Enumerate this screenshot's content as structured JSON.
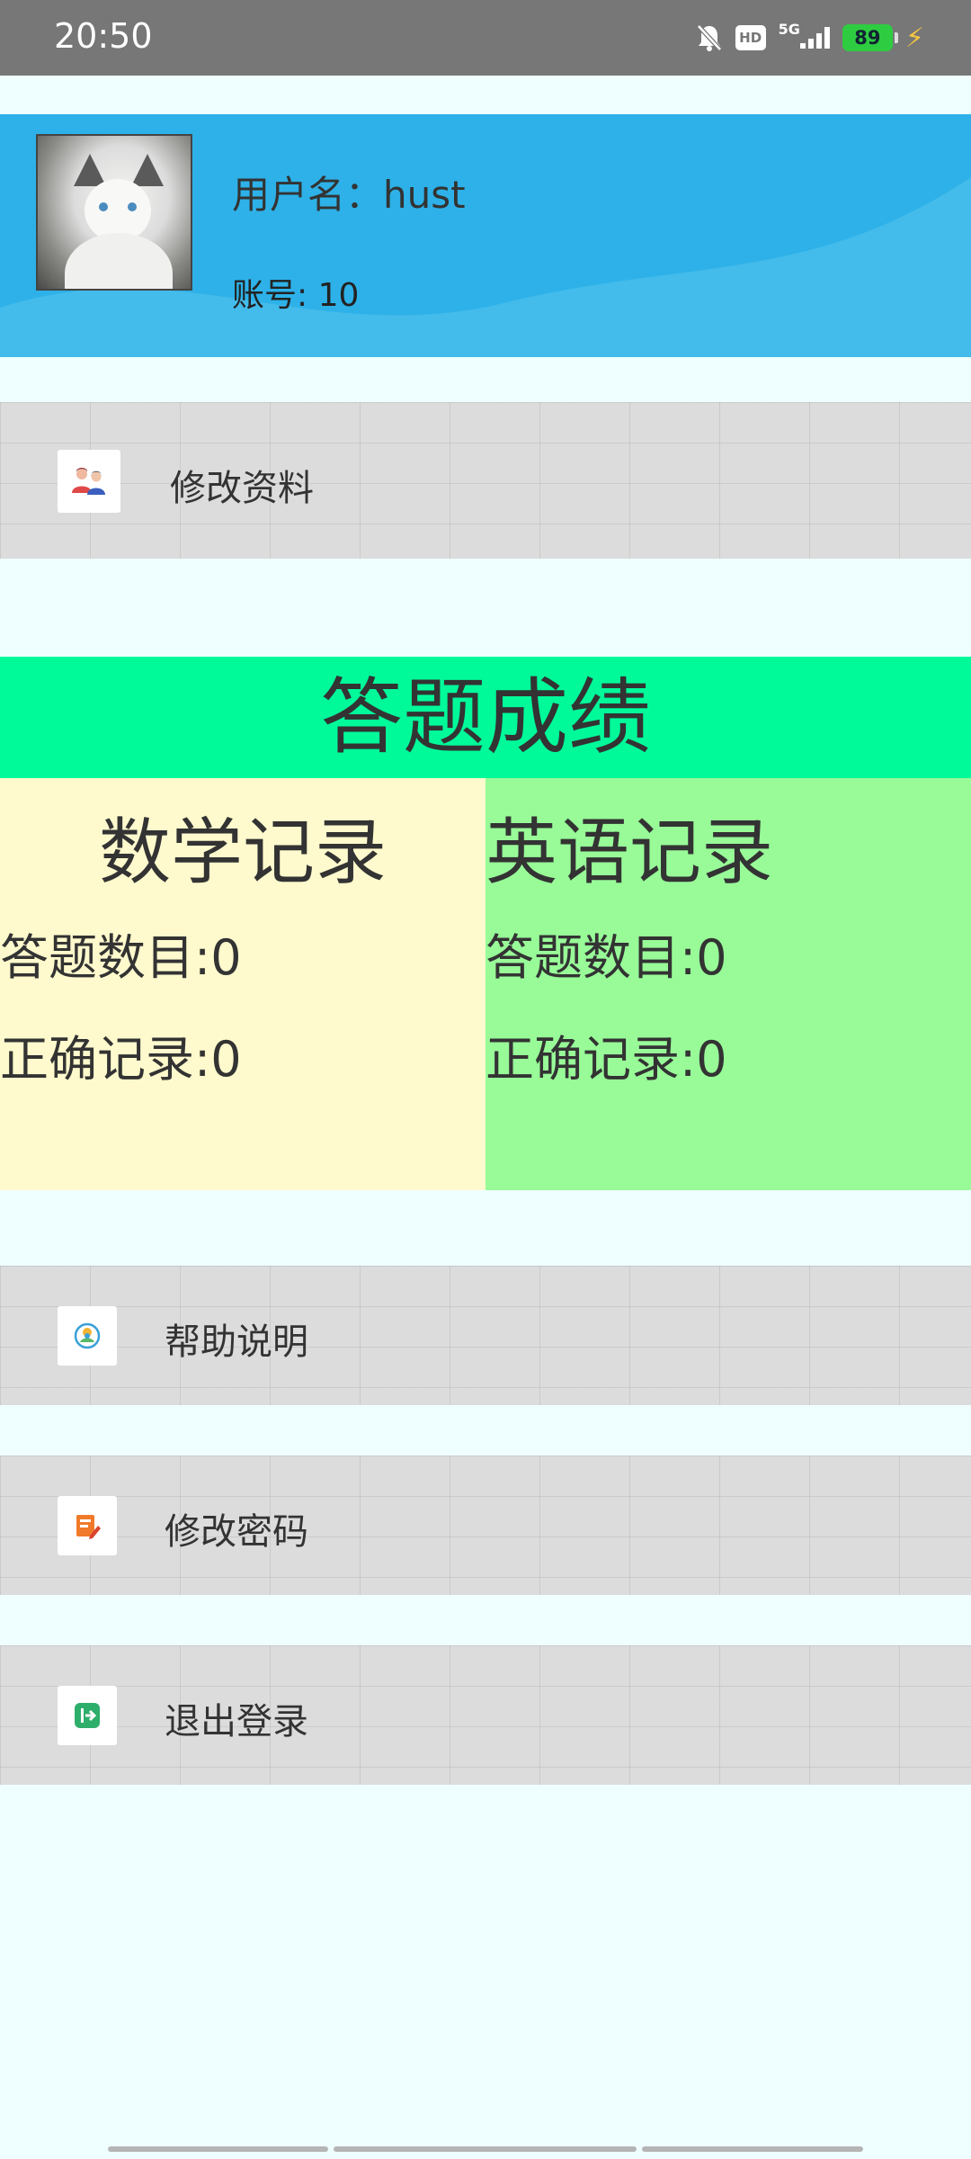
{
  "status_bar": {
    "time": "20:50",
    "icons": [
      "bell-mute-icon",
      "hd-icon",
      "5g-signal-icon",
      "battery-icon",
      "charging-bolt-icon"
    ],
    "hd_label": "HD",
    "network_label": "5G",
    "battery_level": "89"
  },
  "profile": {
    "username_label": "用户名：hust",
    "account_label": "账号: 10",
    "colors": {
      "card": "#2db1e8"
    }
  },
  "menu": {
    "edit_profile": "修改资料",
    "help": "帮助说明",
    "change_password": "修改密码",
    "logout": "退出登录"
  },
  "scores": {
    "title": "答题成绩",
    "math": {
      "title": "数学记录",
      "answered": "答题数目:0",
      "correct": "正确记录:0"
    },
    "english": {
      "title": "英语记录",
      "answered": "答题数目:0",
      "correct": "正确记录:0"
    },
    "colors": {
      "title_bg": "#00fa9a",
      "math_bg": "#fffacd",
      "english_bg": "#98fb98"
    }
  }
}
